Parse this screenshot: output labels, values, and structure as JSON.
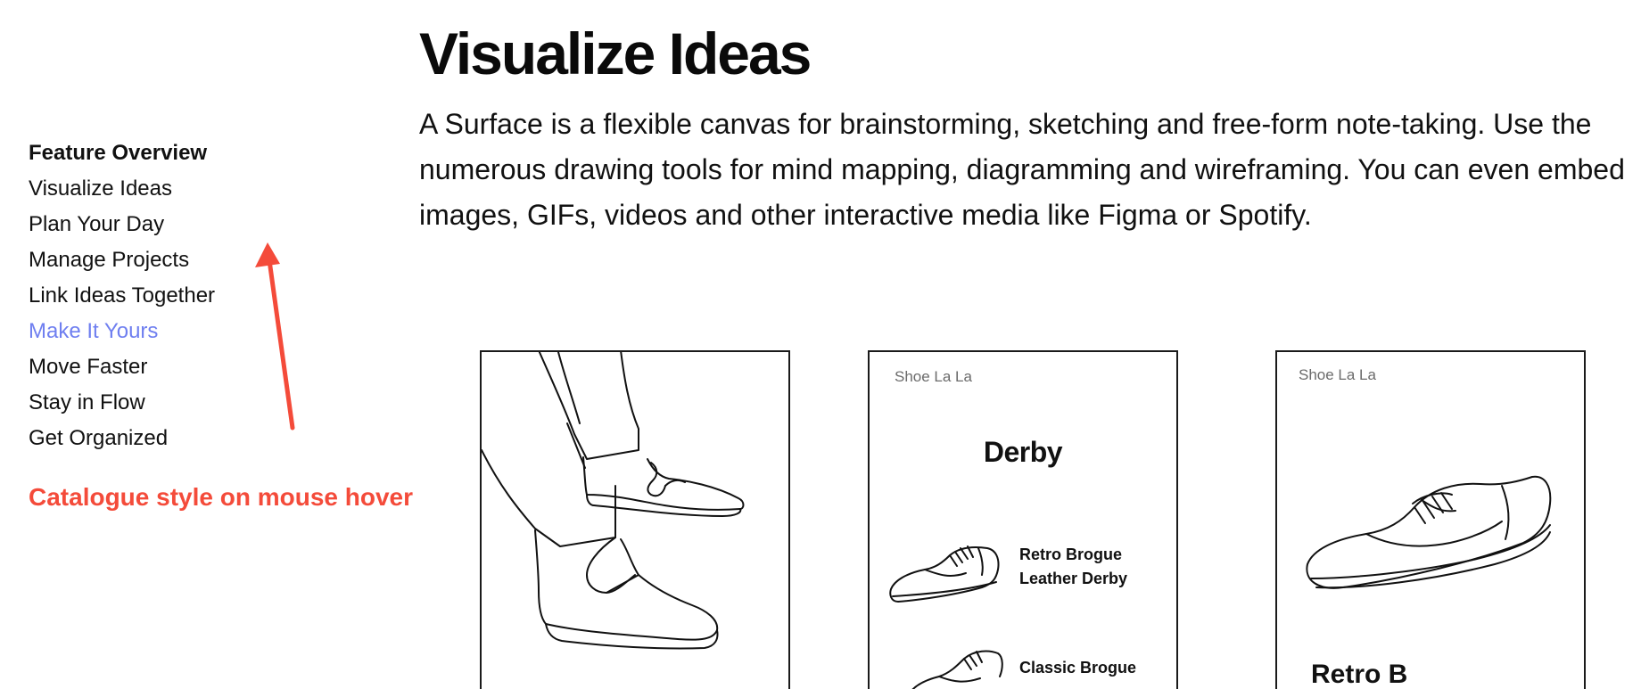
{
  "sidebar": {
    "heading": "Feature Overview",
    "items": [
      {
        "label": "Visualize Ideas"
      },
      {
        "label": "Plan Your Day"
      },
      {
        "label": "Manage Projects"
      },
      {
        "label": "Link Ideas Together"
      },
      {
        "label": "Make It Yours"
      },
      {
        "label": "Move Faster"
      },
      {
        "label": "Stay in Flow"
      },
      {
        "label": "Get Organized"
      }
    ]
  },
  "annotation": "Catalogue style on mouse hover",
  "main": {
    "title": "Visualize Ideas",
    "description": "A Surface is a flexible canvas for brainstorming, sketching and free-form note-taking. Use the numerous drawing tools for mind mapping, diagramming and wireframing. You can even embed images, GIFs, videos and other interactive media like Figma or Spotify."
  },
  "cards": {
    "catalog": {
      "brand": "Shoe La La",
      "title": "Derby",
      "products": [
        {
          "name_line1": "Retro Brogue",
          "name_line2": "Leather Derby"
        },
        {
          "name_line1": "Classic Brogue",
          "name_line2": ""
        }
      ]
    },
    "product": {
      "brand": "Shoe La La",
      "partial_title": "Retro B"
    }
  },
  "colors": {
    "text": "#111111",
    "hover_link": "#6f7ff0",
    "annotation_red": "#f44b3a",
    "card_border": "#1a1a1a",
    "brand_gray": "#6b6b6b"
  }
}
